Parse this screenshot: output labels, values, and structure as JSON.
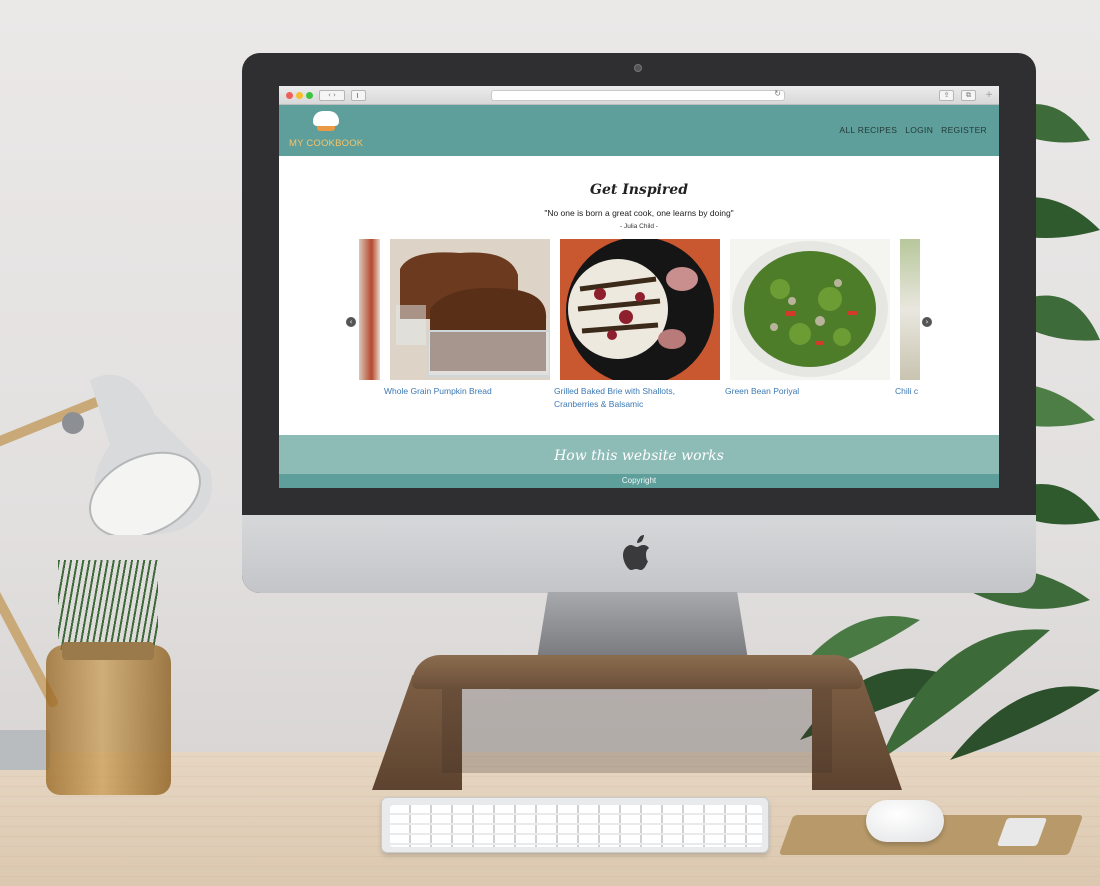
{
  "browser": {
    "nav_arrows": "‹ ›",
    "reload_glyph": "↻",
    "share_glyph": "⇪",
    "tabs_glyph": "⧉",
    "plus_glyph": "+"
  },
  "site": {
    "logo_text": "MY COOKBOOK",
    "nav": [
      "ALL RECIPES",
      "LOGIN",
      "REGISTER"
    ]
  },
  "inspire": {
    "title": "Get Inspired",
    "quote": "\"No one is born a great cook, one learns by doing\"",
    "author": "- Julia Child -"
  },
  "carousel": {
    "prev_glyph": "‹",
    "next_glyph": "›",
    "recipes": [
      "Whole Grain Pumpkin Bread",
      "Grilled Baked Brie with Shallots, Cranberries & Balsamic",
      "Green Bean Poriyal",
      "Chili c"
    ]
  },
  "how": {
    "title": "How this website works"
  },
  "footer": {
    "copyright": "Copyright"
  },
  "colors": {
    "header": "#5e9e9b",
    "how_band": "#8dbbb6",
    "link": "#3b79b4",
    "logo": "#f6c46a"
  },
  "icons": [
    "apple-logo-icon",
    "chef-hat-icon",
    "arrow-left-icon",
    "arrow-right-icon",
    "reload-icon"
  ]
}
